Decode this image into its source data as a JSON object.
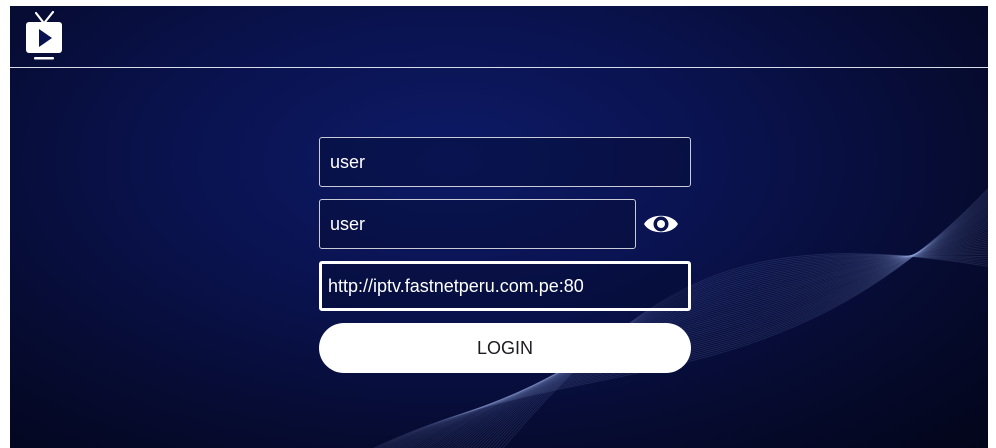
{
  "app": {
    "logo_icon": "tv-play-icon"
  },
  "login_form": {
    "username_value": "user",
    "password_value": "user",
    "url_value": "http://iptv.fastnetperu.com.pe:80",
    "show_password_icon": "eye-icon",
    "login_label": "LOGIN"
  },
  "colors": {
    "background_center": "#0d1a66",
    "background_edge": "#03051a",
    "field_border": "#c9cbd6",
    "focus_border": "#ffffff",
    "button_bg": "#ffffff"
  }
}
